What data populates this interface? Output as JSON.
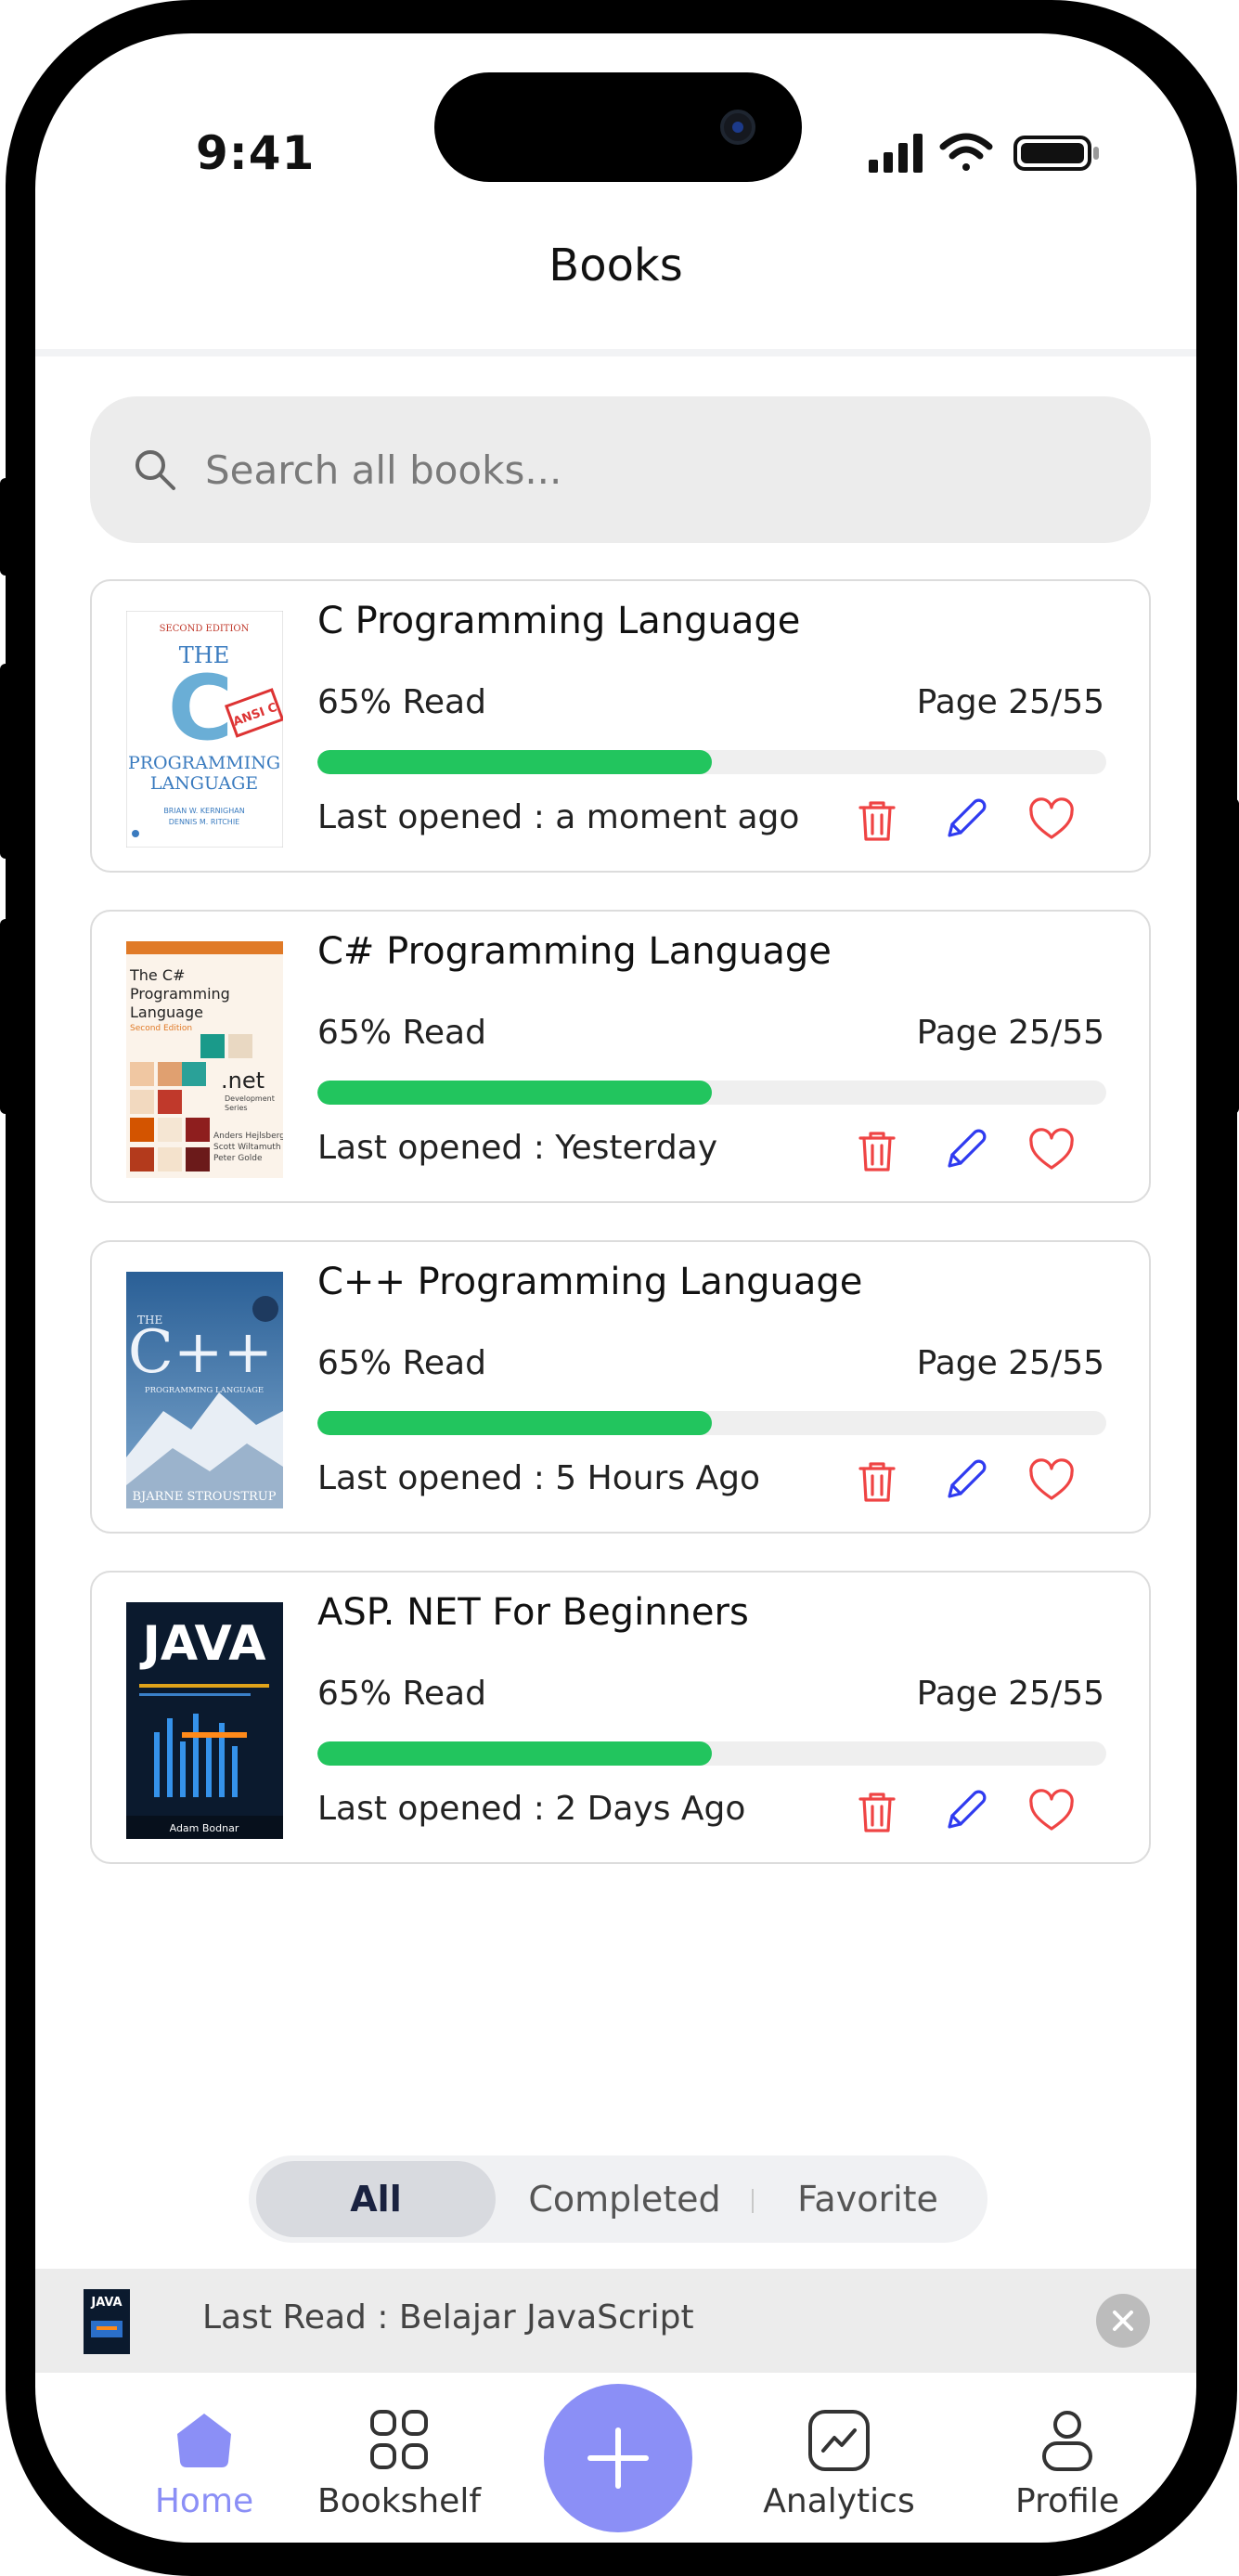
{
  "status_bar": {
    "time": "9:41"
  },
  "header": {
    "title": "Books"
  },
  "search": {
    "placeholder": "Search all books..."
  },
  "books": [
    {
      "title": "C Programming Language",
      "read_label": "65% Read",
      "progress": 0.5,
      "page_info": "Page 25/55",
      "last_opened": "Last opened : a moment ago",
      "cover_text": [
        "SECOND EDITION",
        "THE",
        "C",
        "ANSI C",
        "PROGRAMMING",
        "LANGUAGE",
        "BRIAN W. KERNIGHAN",
        "DENNIS M. RITCHIE"
      ]
    },
    {
      "title": "C# Programming Language",
      "read_label": "65% Read",
      "progress": 0.5,
      "page_info": "Page 25/55",
      "last_opened": "Last opened : Yesterday",
      "cover_text": [
        "The C#",
        "Programming",
        "Language",
        "Second Edition",
        ".net",
        "Development",
        "Series",
        "Anders Hejlsberg",
        "Scott Wiltamuth",
        "Peter Golde"
      ]
    },
    {
      "title": "C++ Programming Language",
      "read_label": "65% Read",
      "progress": 0.5,
      "page_info": "Page 25/55",
      "last_opened": "Last opened : 5 Hours Ago",
      "cover_text": [
        "THE",
        "C++",
        "PROGRAMMING LANGUAGE",
        "BJARNE STROUSTRUP"
      ]
    },
    {
      "title": "ASP. NET For Beginners",
      "read_label": "65% Read",
      "progress": 0.5,
      "page_info": "Page 25/55",
      "last_opened": "Last opened : 2 Days Ago",
      "cover_text": [
        "JAVA",
        "Adam Bodnar"
      ]
    }
  ],
  "filter": {
    "options": [
      "All",
      "Completed",
      "Favorite"
    ],
    "selected": "All"
  },
  "last_read": {
    "label": "Last Read : Belajar JavaScript",
    "cover_text": "JAVA"
  },
  "nav": {
    "home": "Home",
    "bookshelf": "Bookshelf",
    "analytics": "Analytics",
    "profile": "Profile"
  },
  "colors": {
    "accent": "#8b8ff6",
    "progress": "#22c55e",
    "delete": "#ef4444",
    "edit": "#2f3bf0",
    "favorite": "#ef4444"
  }
}
